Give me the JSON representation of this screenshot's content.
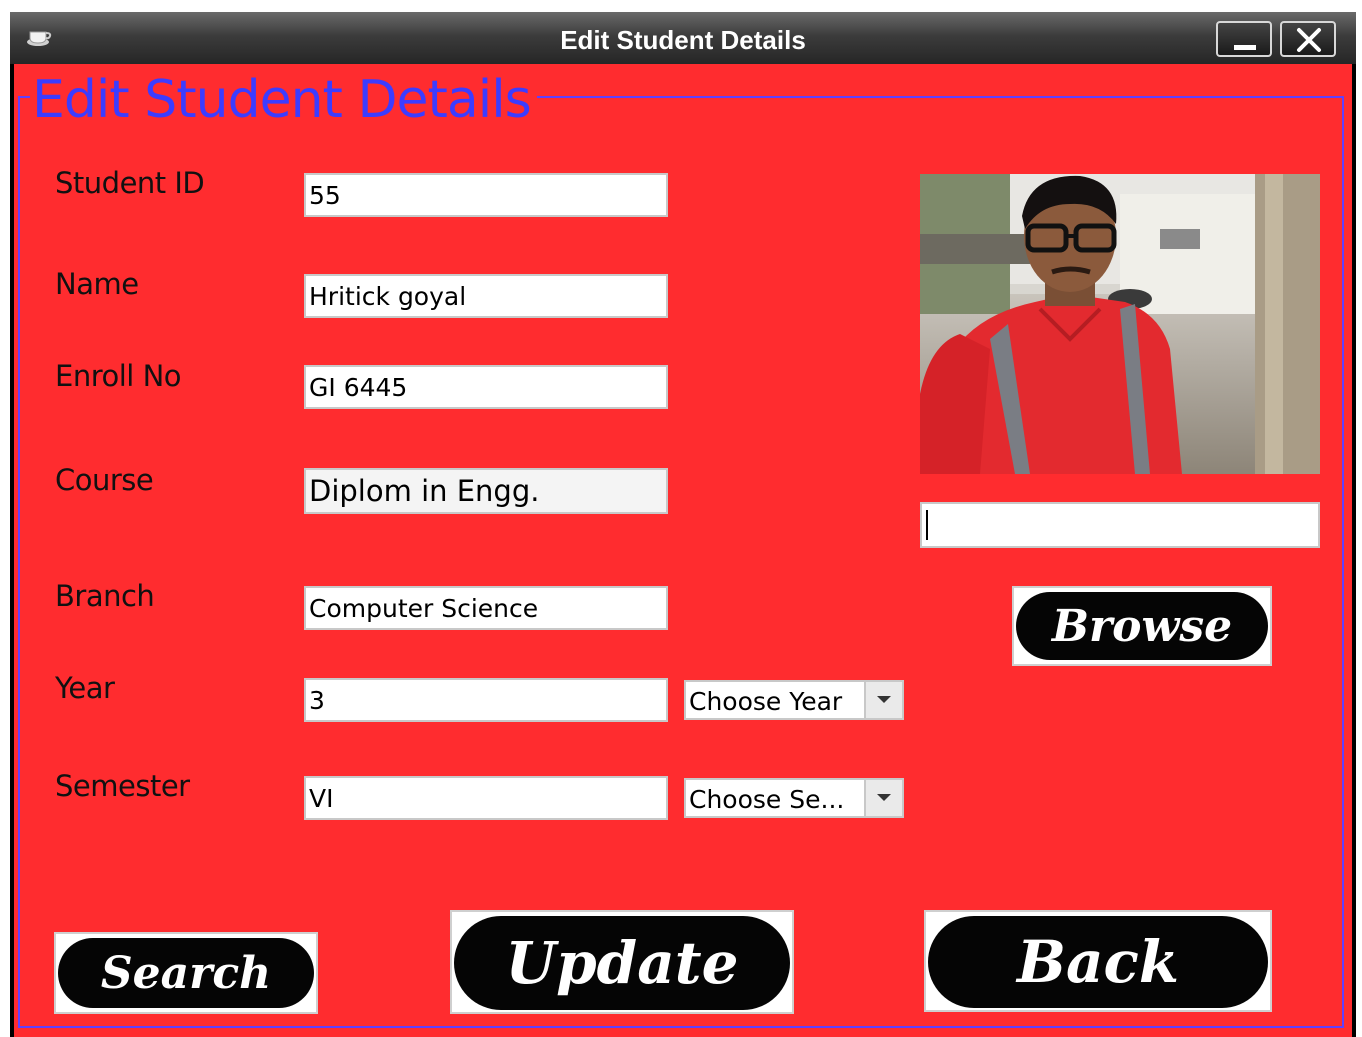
{
  "window": {
    "title": "Edit Student Details",
    "minimize_icon": "minimize-icon",
    "close_icon": "close-icon",
    "app_icon": "java-cup-icon"
  },
  "form": {
    "heading": "Edit Student Details",
    "fields": {
      "student_id": {
        "label": "Student ID",
        "value": "55"
      },
      "name": {
        "label": "Name",
        "value": "Hritick goyal"
      },
      "enroll_no": {
        "label": "Enroll No",
        "value": "GI 6445"
      },
      "course": {
        "label": "Course",
        "value": "Diplom in Engg."
      },
      "branch": {
        "label": "Branch",
        "value": "Computer Science"
      },
      "year": {
        "label": "Year",
        "value": "3",
        "combo": "Choose Year"
      },
      "semester": {
        "label": "Semester",
        "value": "VI",
        "combo": "Choose Se..."
      }
    },
    "photo_path_value": "",
    "buttons": {
      "browse": "Browse",
      "search": "Search",
      "update": "Update",
      "back": "Back"
    }
  },
  "colors": {
    "background": "#ff2c2f",
    "heading": "#3c3cff",
    "button": "#050505"
  }
}
